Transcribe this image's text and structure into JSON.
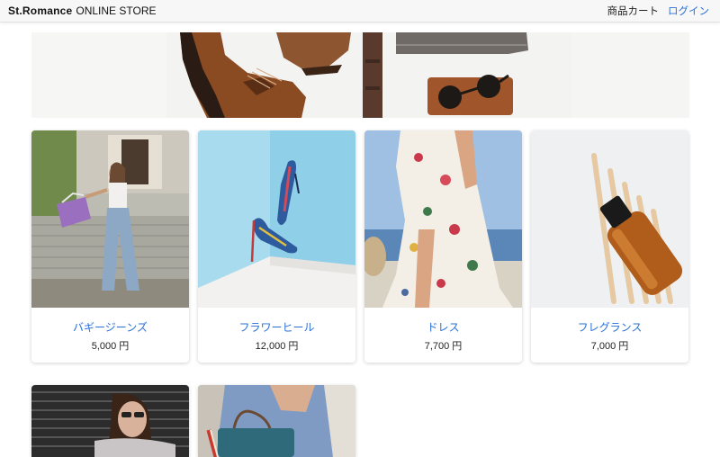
{
  "navbar": {
    "brand_bold": "St.Romance",
    "brand_rest": "ONLINE STORE",
    "cart_label": "商品カート",
    "login_label": "ログイン"
  },
  "carousel": {
    "slide_count": 3,
    "active_index": 1
  },
  "products": [
    {
      "name": "バギージーンズ",
      "price": "5,000",
      "currency": "円"
    },
    {
      "name": "フラワーヒール",
      "price": "12,000",
      "currency": "円"
    },
    {
      "name": "ドレス",
      "price": "7,700",
      "currency": "円"
    },
    {
      "name": "フレグランス",
      "price": "7,000",
      "currency": "円"
    }
  ],
  "colors": {
    "link": "#2a6fd6",
    "navbar_bg": "#f7f7f8"
  }
}
